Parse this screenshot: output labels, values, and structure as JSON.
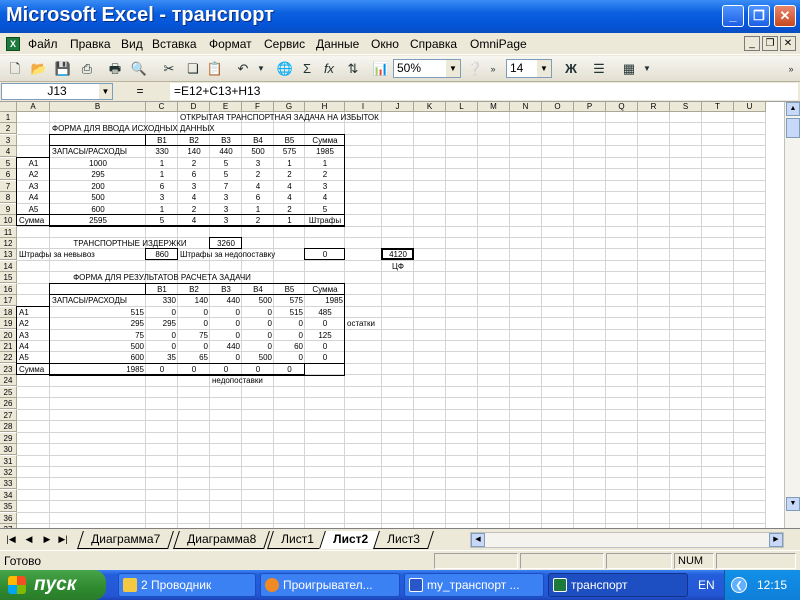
{
  "window": {
    "title": "Microsoft Excel - транспорт"
  },
  "menu": [
    "Файл",
    "Правка",
    "Вид",
    "Вставка",
    "Формат",
    "Сервис",
    "Данные",
    "Окно",
    "Справка",
    "OmniPage"
  ],
  "toolbar": {
    "zoom": "50%",
    "font_size": "14",
    "bold": "Ж",
    "sigma": "Σ",
    "fx": "fx"
  },
  "formula_bar": {
    "name_box": "J13",
    "fx_label": "=",
    "formula": "=E12+C13+H13"
  },
  "columns": [
    "A",
    "B",
    "C",
    "D",
    "E",
    "F",
    "G",
    "H",
    "I",
    "J",
    "K",
    "L",
    "M",
    "N",
    "O",
    "P",
    "Q",
    "R",
    "S",
    "T",
    "U"
  ],
  "rows": [
    "1",
    "2",
    "3",
    "4",
    "5",
    "6",
    "7",
    "8",
    "9",
    "10",
    "11",
    "12",
    "13",
    "14",
    "15",
    "16",
    "17",
    "18",
    "19",
    "20",
    "21",
    "22",
    "23",
    "24",
    "25",
    "26",
    "27",
    "28",
    "29",
    "30",
    "31",
    "32",
    "33",
    "34",
    "35",
    "36",
    "37"
  ],
  "sheet": {
    "title1": "ОТКРЫТАЯ ТРАНСПОРТНАЯ ЗАДАЧА НА ИЗБЫТОК",
    "title2": "ФОРМА ДЛЯ ВВОДА ИСХОДНЫХ ДАННЫХ",
    "input_header": [
      "В1",
      "В2",
      "В3",
      "В4",
      "В5",
      "Сумма"
    ],
    "input_label_row": "ЗАПАСЫ/РАСХОДЫ",
    "input_demand": [
      "330",
      "140",
      "440",
      "500",
      "575",
      "1985"
    ],
    "input_rows": [
      {
        "name": "А1",
        "supply": "1000",
        "costs": [
          "1",
          "2",
          "5",
          "3",
          "1"
        ],
        "penalty": "1"
      },
      {
        "name": "А2",
        "supply": "295",
        "costs": [
          "1",
          "6",
          "5",
          "2",
          "2"
        ],
        "penalty": "2"
      },
      {
        "name": "А3",
        "supply": "200",
        "costs": [
          "6",
          "3",
          "7",
          "4",
          "4"
        ],
        "penalty": "3"
      },
      {
        "name": "А4",
        "supply": "500",
        "costs": [
          "3",
          "4",
          "3",
          "6",
          "4"
        ],
        "penalty": "4"
      },
      {
        "name": "А5",
        "supply": "600",
        "costs": [
          "1",
          "2",
          "3",
          "1",
          "2"
        ],
        "penalty": "5"
      }
    ],
    "input_sum_label": "Сумма",
    "input_sum_supply": "2595",
    "input_sum_row": [
      "5",
      "4",
      "3",
      "2",
      "1"
    ],
    "input_penalty_label": "Штрафы",
    "transport_label": "ТРАНСПОРТНЫЕ ИЗДЕРЖКИ",
    "transport_value": "3260",
    "penalty_unshipped_label": "Штрафы за невывоз",
    "penalty_unshipped_value": "860",
    "penalty_undersupply_label": "Штрафы за недопоставку",
    "penalty_undersupply_value": "0",
    "objective_value": "4120",
    "objective_label": "ЦФ",
    "title3": "ФОРМА ДЛЯ РЕЗУЛЬТАТОВ РАСЧЕТА ЗАДАЧИ",
    "result_header": [
      "В1",
      "В2",
      "В3",
      "В4",
      "В5",
      "Сумма"
    ],
    "result_label_row": "ЗАПАСЫ/РАСХОДЫ",
    "result_demand": [
      "330",
      "140",
      "440",
      "500",
      "575",
      "1985"
    ],
    "result_rows": [
      {
        "name": "А1",
        "supply": "515",
        "values": [
          "0",
          "0",
          "0",
          "0",
          "515"
        ],
        "rest": "485"
      },
      {
        "name": "А2",
        "supply": "295",
        "values": [
          "295",
          "0",
          "0",
          "0",
          "0"
        ],
        "rest": "0"
      },
      {
        "name": "А3",
        "supply": "75",
        "values": [
          "0",
          "75",
          "0",
          "0",
          "0"
        ],
        "rest": "125"
      },
      {
        "name": "А4",
        "supply": "500",
        "values": [
          "0",
          "0",
          "440",
          "0",
          "60"
        ],
        "rest": "0"
      },
      {
        "name": "А5",
        "supply": "600",
        "values": [
          "35",
          "65",
          "0",
          "500",
          "0"
        ],
        "rest": "0"
      }
    ],
    "rest_label": "остатки",
    "result_sum_label": "Сумма",
    "result_sum_supply": "1985",
    "result_sum_row": [
      "0",
      "0",
      "0",
      "0",
      "0"
    ],
    "undersupply_label": "недопоставки"
  },
  "tabs": [
    "Диаграмма7",
    "Диаграмма8",
    "Лист1",
    "Лист2",
    "Лист3"
  ],
  "active_tab": "Лист2",
  "status": {
    "text": "Готово",
    "num": "NUM"
  },
  "taskbar": {
    "start": "пуск",
    "items": [
      "2 Проводник",
      "Проигрывател...",
      "my_транспорт ...",
      "транспорт"
    ],
    "lang": "EN",
    "clock": "12:15"
  }
}
